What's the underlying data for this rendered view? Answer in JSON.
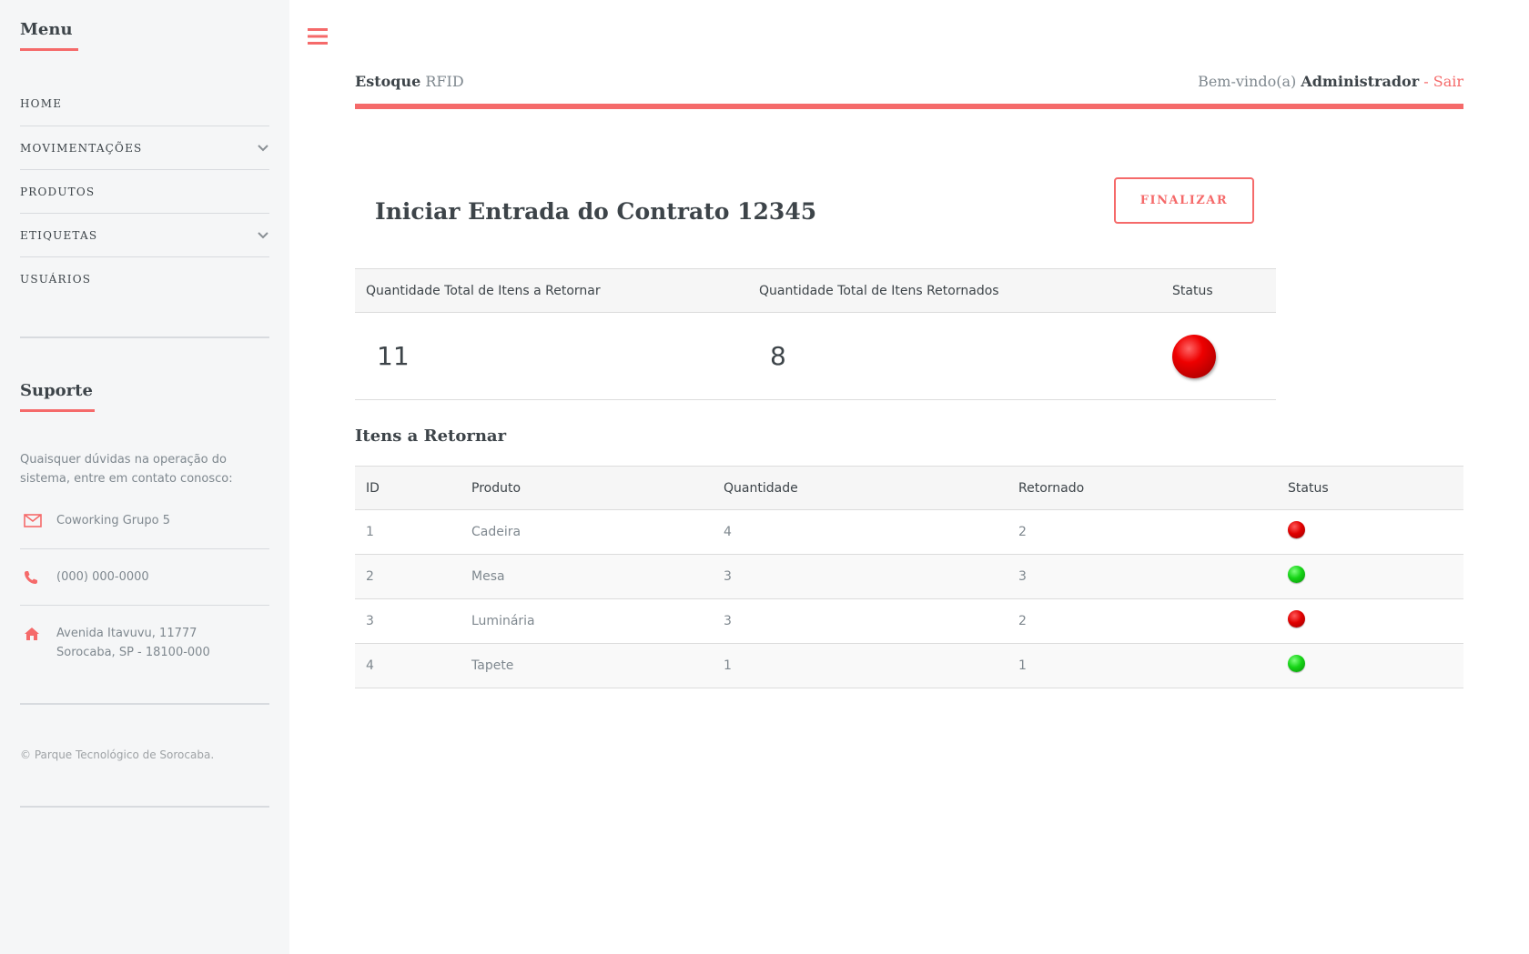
{
  "sidebar": {
    "menu_heading": "Menu",
    "menu_items": [
      {
        "label": "HOME",
        "has_submenu": false
      },
      {
        "label": "MOVIMENTAÇÕES",
        "has_submenu": true
      },
      {
        "label": "PRODUTOS",
        "has_submenu": false
      },
      {
        "label": "ETIQUETAS",
        "has_submenu": true
      },
      {
        "label": "USUÁRIOS",
        "has_submenu": false
      }
    ],
    "support_heading": "Suporte",
    "support_text": "Quaisquer dúvidas na operação do sistema, entre em contato conosco:",
    "contact": {
      "email_icon": "envelope-icon",
      "email": "Coworking Grupo 5",
      "phone_icon": "phone-icon",
      "phone": "(000) 000-0000",
      "address_icon": "home-icon",
      "address_line1": "Avenida Itavuvu, 11777",
      "address_line2": "Sorocaba, SP - 18100-000"
    },
    "copyright": "© Parque Tecnológico de Sorocaba."
  },
  "header": {
    "menu_icon": "hamburger-icon",
    "brand_strong": "Estoque",
    "brand_light": "RFID",
    "welcome": "Bem-vindo(a)",
    "user": "Administrador",
    "separator": "-",
    "logout": "Sair"
  },
  "main": {
    "title": "Iniciar Entrada do Contrato 12345",
    "finalize_button": "FINALIZAR",
    "summary": {
      "headers": [
        "Quantidade Total de Itens a Retornar",
        "Quantidade Total de Itens Retornados",
        "Status"
      ],
      "total_to_return": "11",
      "total_returned": "8",
      "status": "red"
    },
    "items_title": "Itens a Retornar",
    "items_headers": [
      "ID",
      "Produto",
      "Quantidade",
      "Retornado",
      "Status"
    ],
    "items": [
      {
        "id": "1",
        "produto": "Cadeira",
        "quantidade": "4",
        "retornado": "2",
        "status": "red"
      },
      {
        "id": "2",
        "produto": "Mesa",
        "quantidade": "3",
        "retornado": "3",
        "status": "green"
      },
      {
        "id": "3",
        "produto": "Luminária",
        "quantidade": "3",
        "retornado": "2",
        "status": "red"
      },
      {
        "id": "4",
        "produto": "Tapete",
        "quantidade": "1",
        "retornado": "1",
        "status": "green"
      }
    ]
  },
  "colors": {
    "accent": "#f56a6a",
    "status_red": "#e00000",
    "status_green": "#16d416",
    "sidebar_bg": "#f5f6f7"
  }
}
